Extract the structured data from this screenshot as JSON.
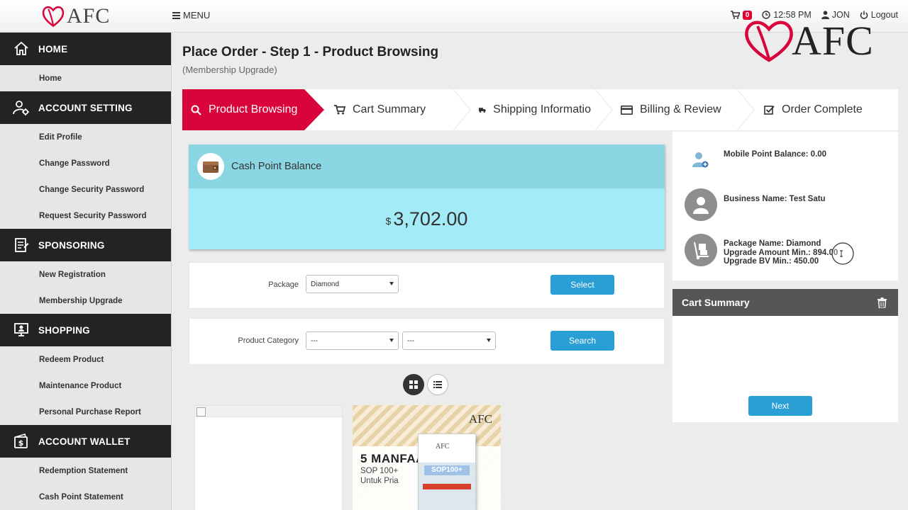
{
  "header": {
    "brand": "AFC",
    "menu_label": "MENU",
    "cart_count": "0",
    "time": "12:58 PM",
    "user": "JON",
    "logout": "Logout"
  },
  "watermark": "AFC",
  "sidebar": {
    "sections": [
      {
        "title": "HOME",
        "icon": "home-icon",
        "items": [
          "Home"
        ]
      },
      {
        "title": "ACCOUNT SETTING",
        "icon": "user-gear-icon",
        "items": [
          "Edit Profile",
          "Change Password",
          "Change Security Password",
          "Request Security Password"
        ]
      },
      {
        "title": "SPONSORING",
        "icon": "clipboard-icon",
        "items": [
          "New Registration",
          "Membership Upgrade"
        ]
      },
      {
        "title": "SHOPPING",
        "icon": "shop-icon",
        "items": [
          "Redeem Product",
          "Maintenance Product",
          "Personal Purchase Report"
        ]
      },
      {
        "title": "ACCOUNT WALLET",
        "icon": "wallet-icon",
        "items": [
          "Redemption Statement",
          "Cash Point Statement"
        ]
      }
    ]
  },
  "page": {
    "title": "Place Order - Step 1 - Product Browsing",
    "subtitle": "(Membership Upgrade)"
  },
  "steps": [
    {
      "label": "Product Browsing",
      "icon": "search-icon"
    },
    {
      "label": "Cart Summary",
      "icon": "cart-icon"
    },
    {
      "label": "Shipping Informatio",
      "icon": "truck-icon"
    },
    {
      "label": "Billing & Review",
      "icon": "credit-card-icon"
    },
    {
      "label": "Order Complete",
      "icon": "check-square-icon"
    }
  ],
  "cash": {
    "label": "Cash Point Balance",
    "currency": "$",
    "amount": "3,702.00"
  },
  "package_filter": {
    "label": "Package",
    "selected": "Diamond",
    "button": "Select"
  },
  "category_filter": {
    "label": "Product Category",
    "selected1": "---",
    "selected2": "---",
    "button": "Search"
  },
  "products": [
    {
      "brand": "AFC",
      "title": "5 MANFAAT",
      "line1": "SOP 100+",
      "line2": "Untuk Pria",
      "box_label": "SOP100+"
    }
  ],
  "info": {
    "mobile_point": "Mobile Point Balance: 0.00",
    "business_name": "Business Name: Test Satu",
    "package_name": "Package Name: Diamond",
    "upgrade_amount": "Upgrade Amount Min.: 894.00",
    "upgrade_bv": "Upgrade BV Min.: 450.00"
  },
  "cart": {
    "title": "Cart Summary",
    "next": "Next"
  },
  "colors": {
    "accent_red": "#d8043b",
    "button_blue": "#2a9fd6",
    "cash_header": "#8ad6e3",
    "cash_body": "#a2ebf7"
  }
}
